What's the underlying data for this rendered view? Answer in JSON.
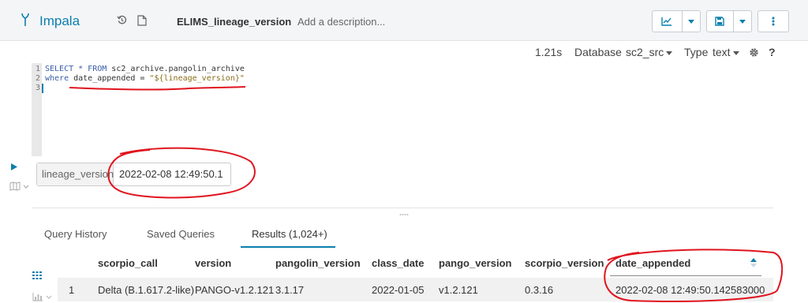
{
  "header": {
    "app_name": "Impala",
    "query_name": "ELIMS_lineage_version",
    "description_placeholder": "Add a description..."
  },
  "meta": {
    "execution_time": "1.21s",
    "database_label": "Database",
    "database_value": "sc2_src",
    "type_label": "Type",
    "type_value": "text",
    "help": "?"
  },
  "editor": {
    "line_numbers": [
      "1",
      "2",
      "3"
    ],
    "line1_kw": "SELECT * FROM ",
    "line1_rest": "sc2_archive.pangolin_archive",
    "line2_kw": "where ",
    "line2_col": "date_appended = ",
    "line2_str": "\"${lineage_version}\""
  },
  "parameter": {
    "label": "lineage_version",
    "value": "2022-02-08 12:49:50.1"
  },
  "tabs": [
    "Query History",
    "Saved Queries",
    "Results (1,024+)"
  ],
  "results": {
    "columns": [
      "scorpio_call",
      "version",
      "pangolin_version",
      "class_date",
      "pango_version",
      "scorpio_version",
      "date_appended"
    ],
    "rows": [
      [
        "1",
        "Delta (B.1.617.2-like)",
        "PANGO-v1.2.121",
        "3.1.17",
        "2022-01-05",
        "v1.2.121",
        "0.3.16",
        "2022-02-08 12:49:50.142583000"
      ]
    ]
  },
  "colors": {
    "accent": "#0b7fad",
    "annotation": "#e0141e"
  }
}
